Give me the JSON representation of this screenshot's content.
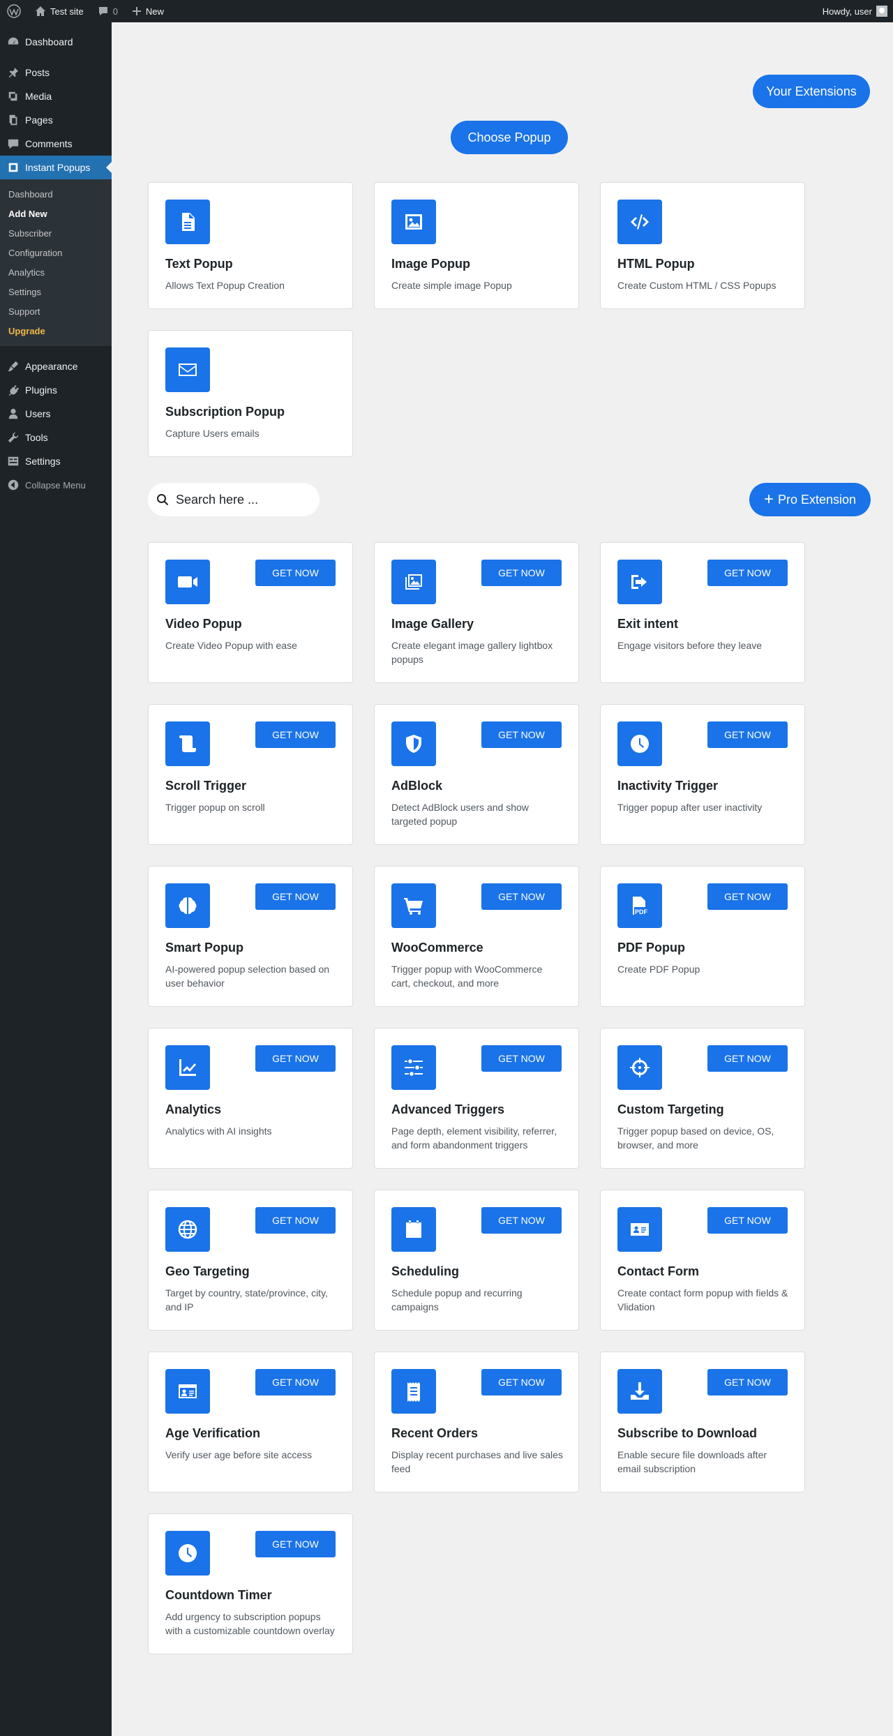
{
  "admin_bar": {
    "site_name": "Test site",
    "comments_count": "0",
    "new_label": "New",
    "howdy": "Howdy, user"
  },
  "sidebar": {
    "menu": [
      {
        "label": "Dashboard",
        "icon": "dashboard-icon"
      },
      {
        "label": "Posts",
        "icon": "pin-icon"
      },
      {
        "label": "Media",
        "icon": "media-icon"
      },
      {
        "label": "Pages",
        "icon": "pages-icon"
      },
      {
        "label": "Comments",
        "icon": "comment-icon"
      },
      {
        "label": "Instant Popups",
        "icon": "popup-icon"
      }
    ],
    "submenu": [
      "Dashboard",
      "Add New",
      "Subscriber",
      "Configuration",
      "Analytics",
      "Settings",
      "Support",
      "Upgrade"
    ],
    "menu_bottom": [
      {
        "label": "Appearance",
        "icon": "brush-icon"
      },
      {
        "label": "Plugins",
        "icon": "plug-icon"
      },
      {
        "label": "Users",
        "icon": "user-icon"
      },
      {
        "label": "Tools",
        "icon": "wrench-icon"
      },
      {
        "label": "Settings",
        "icon": "settings-icon"
      }
    ],
    "collapse_label": "Collapse Menu"
  },
  "buttons": {
    "your_extensions": "Your Extensions",
    "choose_popup": "Choose Popup",
    "pro_extension": "Pro Extension"
  },
  "search": {
    "placeholder": "Search here ..."
  },
  "popup_types": [
    {
      "title": "Text Popup",
      "desc": "Allows Text Popup Creation",
      "icon": "document-icon"
    },
    {
      "title": "Image Popup",
      "desc": "Create simple image Popup",
      "icon": "image-icon"
    },
    {
      "title": "HTML Popup",
      "desc": "Create Custom HTML / CSS Popups",
      "icon": "code-icon"
    },
    {
      "title": "Subscription Popup",
      "desc": "Capture Users emails",
      "icon": "envelope-icon"
    }
  ],
  "get_now_label": "GET NOW",
  "extensions": [
    {
      "title": "Video Popup",
      "desc": "Create Video Popup with ease",
      "icon": "video-icon"
    },
    {
      "title": "Image Gallery",
      "desc": "Create elegant image gallery lightbox popups",
      "icon": "gallery-icon"
    },
    {
      "title": "Exit intent",
      "desc": "Engage visitors before they leave",
      "icon": "exit-icon"
    },
    {
      "title": "Scroll Trigger",
      "desc": "Trigger popup on scroll",
      "icon": "scroll-icon"
    },
    {
      "title": "AdBlock",
      "desc": "Detect AdBlock users and show targeted popup",
      "icon": "shield-icon"
    },
    {
      "title": "Inactivity Trigger",
      "desc": "Trigger popup after user inactivity",
      "icon": "clock-icon"
    },
    {
      "title": "Smart Popup",
      "desc": "AI-powered popup selection based on user behavior",
      "icon": "brain-icon"
    },
    {
      "title": "WooCommerce",
      "desc": "Trigger popup with WooCommerce cart, checkout, and more",
      "icon": "cart-icon"
    },
    {
      "title": "PDF Popup",
      "desc": "Create PDF Popup",
      "icon": "pdf-icon"
    },
    {
      "title": "Analytics",
      "desc": "Analytics with AI insights",
      "icon": "chart-line-icon"
    },
    {
      "title": "Advanced Triggers",
      "desc": "Page depth, element visibility, referrer, and form abandonment triggers",
      "icon": "sliders-icon"
    },
    {
      "title": "Custom Targeting",
      "desc": "Trigger popup based on device, OS, browser, and more",
      "icon": "crosshairs-icon"
    },
    {
      "title": "Geo Targeting",
      "desc": "Target by country, state/province, city, and IP",
      "icon": "globe-icon"
    },
    {
      "title": "Scheduling",
      "desc": "Schedule popup and recurring campaigns",
      "icon": "calendar-icon"
    },
    {
      "title": "Contact Form",
      "desc": "Create contact form popup with fields & Vlidation",
      "icon": "contact-card-icon"
    },
    {
      "title": "Age Verification",
      "desc": "Verify user age before site access",
      "icon": "id-card-icon"
    },
    {
      "title": "Recent Orders",
      "desc": "Display recent purchases and live sales feed",
      "icon": "receipt-icon"
    },
    {
      "title": "Subscribe to Download",
      "desc": "Enable secure file downloads after email subscription",
      "icon": "download-icon"
    },
    {
      "title": "Countdown Timer",
      "desc": "Add urgency to subscription popups with a customizable countdown overlay",
      "icon": "clock-icon"
    }
  ],
  "colors": {
    "accent": "#1a73e8",
    "admin_bg": "#1d2327",
    "current_menu": "#2271b1",
    "upgrade": "#f0b849"
  }
}
